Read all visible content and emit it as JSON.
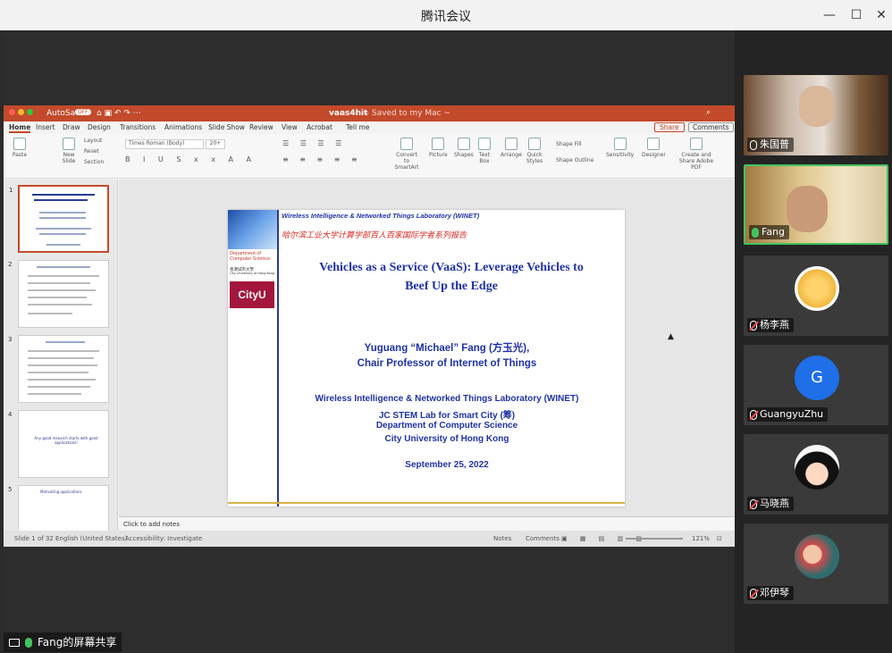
{
  "window": {
    "title": "腾讯会议"
  },
  "ppt": {
    "autosave": "AutoSave",
    "autosave_state": "OFF",
    "doc_title": "vaas4hit",
    "saved_status": "— Saved to my Mac ~",
    "tabs": [
      "Home",
      "Insert",
      "Draw",
      "Design",
      "Transitions",
      "Animations",
      "Slide Show",
      "Review",
      "View",
      "Acrobat",
      "Tell me"
    ],
    "share_label": "Share",
    "comments_label": "Comments",
    "ribbon": {
      "paste": "Paste",
      "new_slide": "New Slide",
      "layout": "Layout",
      "reset": "Reset",
      "section": "Section",
      "font": "Times Roman (Body)",
      "size": "20+",
      "convert": "Convert to SmartArt",
      "picture": "Picture",
      "shapes": "Shapes",
      "textbox": "Text Box",
      "arrange": "Arrange",
      "quick_styles": "Quick Styles",
      "shape_fill": "Shape Fill",
      "shape_outline": "Shape Outline",
      "sensitivity": "Sensitivity",
      "designer": "Designer",
      "create_share": "Create and Share Adobe PDF"
    },
    "thumbnail_numbers": [
      "1",
      "2",
      "3",
      "4",
      "5"
    ],
    "thumb4_text": "Any good research starts with good applications!",
    "thumb5_text": "Motivating applications",
    "notes_placeholder": "Click to add notes",
    "status": {
      "slide_of": "Slide 1 of 32",
      "language": "English (United States)",
      "accessibility": "Accessibility: Investigate",
      "notes": "Notes",
      "comments": "Comments",
      "zoom": "121%"
    }
  },
  "slide": {
    "lab_header": "Wireless Intelligence & Networked Things Laboratory (WINET)",
    "cn_header": "哈尔滨工业大学计算学部百人百家国际学者系列报告",
    "dept": "Department of Computer Science",
    "cityu_cn": "香港城市大學",
    "cityu_en": "City University of Hong Kong",
    "logo": "CityU",
    "title_line1": "Vehicles as a Service (VaaS): Leverage Vehicles to",
    "title_line2": "Beef Up the Edge",
    "speaker_name": "Yuguang “Michael” Fang (方玉光),",
    "speaker_title": "Chair Professor of Internet of Things",
    "affil1": "Wireless Intelligence & Networked Things Laboratory (WINET)",
    "affil2": "JC STEM Lab for Smart City (筹)",
    "affil3": "Department of Computer Science",
    "affil4": "City University of Hong Kong",
    "date": "September 25, 2022"
  },
  "participants": [
    {
      "name": "朱国普",
      "avatar_letter": ""
    },
    {
      "name": "Fang",
      "avatar_letter": ""
    },
    {
      "name": "杨李燕",
      "avatar_letter": ""
    },
    {
      "name": "GuangyuZhu",
      "avatar_letter": "G"
    },
    {
      "name": "马晓燕",
      "avatar_letter": ""
    },
    {
      "name": "邓伊琴",
      "avatar_letter": ""
    }
  ],
  "share_indicator": "Fang的屏幕共享",
  "colors": {
    "accent_green": "#43c35e",
    "ppt_red": "#c34a2b",
    "slide_blue": "#1f33a8",
    "slide_red": "#d9281f"
  }
}
